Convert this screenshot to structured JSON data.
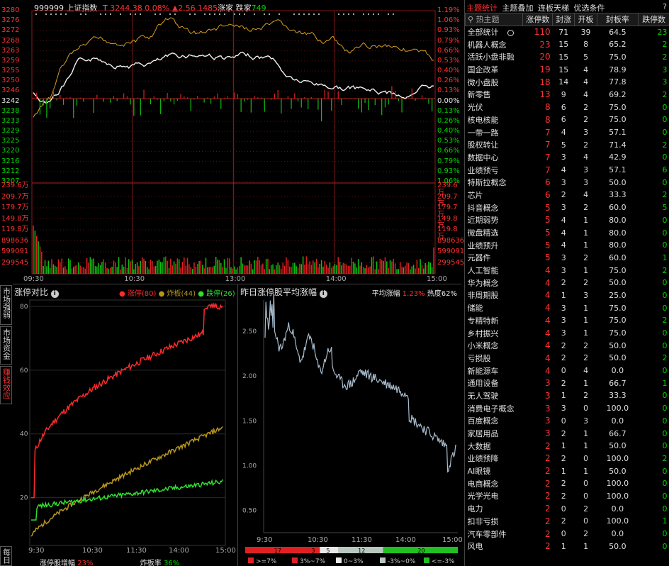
{
  "index": {
    "code": "999999",
    "name": "上证指数",
    "flag": "T",
    "price": "3244.38",
    "pct": "0.08%",
    "change": "▲2.56",
    "up_label": "涨家",
    "up_count": "1485",
    "down_label": "跌家",
    "down_count": "749"
  },
  "price_axis": [
    "3280",
    "3276",
    "3272",
    "3268",
    "3263",
    "3259",
    "3255",
    "3250",
    "3246",
    "3242",
    "3238",
    "3233",
    "3229",
    "3225",
    "3220",
    "3216",
    "3212",
    "3207"
  ],
  "pct_axis": [
    "1.19%",
    "1.06%",
    "0.93%",
    "0.79%",
    "0.66%",
    "0.53%",
    "0.40%",
    "0.26%",
    "0.13%",
    "0.00%",
    "0.13%",
    "0.26%",
    "0.40%",
    "0.53%",
    "0.66%",
    "0.79%",
    "0.93%",
    "1.06%"
  ],
  "vol_axis": [
    "239.6万",
    "209.7万",
    "179.7万",
    "149.8万",
    "119.8万",
    "898636",
    "599091",
    "299545"
  ],
  "time_axis": [
    "09:30",
    "10:30",
    "13:00",
    "14:00",
    "15:00"
  ],
  "left_tabs": [
    "市场强弱",
    "市场资金",
    "赚钱效应",
    "每日"
  ],
  "limit_chart": {
    "title": "涨停对比",
    "legend": [
      {
        "label": "涨停(80)",
        "color": "#ff2a2a"
      },
      {
        "label": "炸板(44)",
        "color": "#b8961e"
      },
      {
        "label": "跌停(26)",
        "color": "#30e030"
      }
    ],
    "y_ticks": [
      "80",
      "60",
      "40",
      "20"
    ],
    "x_ticks": [
      "9:30",
      "10:30",
      "11:30",
      "14:00",
      "15:00"
    ],
    "footer_left_label": "涨停股增幅",
    "footer_left_value": "23%",
    "footer_right_label": "炸板率",
    "footer_right_value": "36%"
  },
  "avg_chart": {
    "title": "昨日涨停股平均涨幅",
    "metric_label": "平均涨幅",
    "metric_value": "1.23%",
    "heat_label": "热度",
    "heat_value": "62%",
    "y_ticks": [
      "2.50",
      "2.00",
      "1.50",
      "1.00",
      "0.50"
    ],
    "x_ticks": [
      "9:30",
      "10:30",
      "11:30",
      "14:00",
      "15:00"
    ],
    "bar_counts": [
      "17",
      "3",
      "5",
      "12",
      "20"
    ],
    "bar_legend": [
      ">=7%",
      "3%~7%",
      "0~3%",
      "-3%~0%",
      "<=-3%"
    ],
    "bar_colors": [
      "#e02020",
      "#e02020",
      "#e8e8e8",
      "#b8c8c0",
      "#20c020"
    ]
  },
  "right_panel": {
    "tabs": [
      "主题统计",
      "主题叠加",
      "连板天梯",
      "优选条件"
    ],
    "help": "?",
    "headers": [
      "热主题",
      "涨停数",
      "封涨",
      "开板",
      "封板率",
      "跌停数"
    ],
    "rows": [
      [
        "全部统计",
        "110",
        "71",
        "39",
        "64.5",
        "23"
      ],
      [
        "机器人概念",
        "23",
        "15",
        "8",
        "65.2",
        "2"
      ],
      [
        "活跃小盘非融",
        "20",
        "15",
        "5",
        "75.0",
        "2"
      ],
      [
        "国企改革",
        "19",
        "15",
        "4",
        "78.9",
        "3"
      ],
      [
        "微小盘股",
        "18",
        "14",
        "4",
        "77.8",
        "3"
      ],
      [
        "新零售",
        "13",
        "9",
        "4",
        "69.2",
        "2"
      ],
      [
        "光伏",
        "8",
        "6",
        "2",
        "75.0",
        "0"
      ],
      [
        "核电核能",
        "8",
        "6",
        "2",
        "75.0",
        "0"
      ],
      [
        "一带一路",
        "7",
        "4",
        "3",
        "57.1",
        "0"
      ],
      [
        "股权转让",
        "7",
        "5",
        "2",
        "71.4",
        "2"
      ],
      [
        "数据中心",
        "7",
        "3",
        "4",
        "42.9",
        "0"
      ],
      [
        "业绩预亏",
        "7",
        "4",
        "3",
        "57.1",
        "6"
      ],
      [
        "特斯拉概念",
        "6",
        "3",
        "3",
        "50.0",
        "0"
      ],
      [
        "芯片",
        "6",
        "2",
        "4",
        "33.3",
        "2"
      ],
      [
        "抖音概念",
        "5",
        "3",
        "2",
        "60.0",
        "5"
      ],
      [
        "近期弱势",
        "5",
        "4",
        "1",
        "80.0",
        "0"
      ],
      [
        "微盘精选",
        "5",
        "4",
        "1",
        "80.0",
        "0"
      ],
      [
        "业绩预升",
        "5",
        "4",
        "1",
        "80.0",
        "0"
      ],
      [
        "元器件",
        "5",
        "3",
        "2",
        "60.0",
        "1"
      ],
      [
        "人工智能",
        "4",
        "3",
        "1",
        "75.0",
        "2"
      ],
      [
        "华为概念",
        "4",
        "2",
        "2",
        "50.0",
        "0"
      ],
      [
        "非周期股",
        "4",
        "1",
        "3",
        "25.0",
        "0"
      ],
      [
        "储能",
        "4",
        "3",
        "1",
        "75.0",
        "0"
      ],
      [
        "专精特新",
        "4",
        "3",
        "1",
        "75.0",
        "2"
      ],
      [
        "乡村振兴",
        "4",
        "3",
        "1",
        "75.0",
        "0"
      ],
      [
        "小米概念",
        "4",
        "2",
        "2",
        "50.0",
        "0"
      ],
      [
        "亏损股",
        "4",
        "2",
        "2",
        "50.0",
        "2"
      ],
      [
        "新能源车",
        "4",
        "0",
        "4",
        "0.0",
        "0"
      ],
      [
        "通用设备",
        "3",
        "2",
        "1",
        "66.7",
        "1"
      ],
      [
        "无人驾驶",
        "3",
        "1",
        "2",
        "33.3",
        "0"
      ],
      [
        "消费电子概念",
        "3",
        "3",
        "0",
        "100.0",
        "0"
      ],
      [
        "百度概念",
        "3",
        "0",
        "3",
        "0.0",
        "0"
      ],
      [
        "家居用品",
        "3",
        "2",
        "1",
        "66.7",
        "0"
      ],
      [
        "大数据",
        "2",
        "1",
        "1",
        "50.0",
        "0"
      ],
      [
        "业绩预降",
        "2",
        "2",
        "0",
        "100.0",
        "2"
      ],
      [
        "AI眼镜",
        "2",
        "1",
        "1",
        "50.0",
        "0"
      ],
      [
        "电商概念",
        "2",
        "2",
        "0",
        "100.0",
        "0"
      ],
      [
        "光学光电",
        "2",
        "2",
        "0",
        "100.0",
        "0"
      ],
      [
        "电力",
        "2",
        "0",
        "2",
        "0.0",
        "0"
      ],
      [
        "扣非亏损",
        "2",
        "2",
        "0",
        "100.0",
        "1"
      ],
      [
        "汽车零部件",
        "2",
        "0",
        "2",
        "0.0",
        "0"
      ],
      [
        "风电",
        "2",
        "1",
        "1",
        "50.0",
        "0"
      ]
    ]
  }
}
